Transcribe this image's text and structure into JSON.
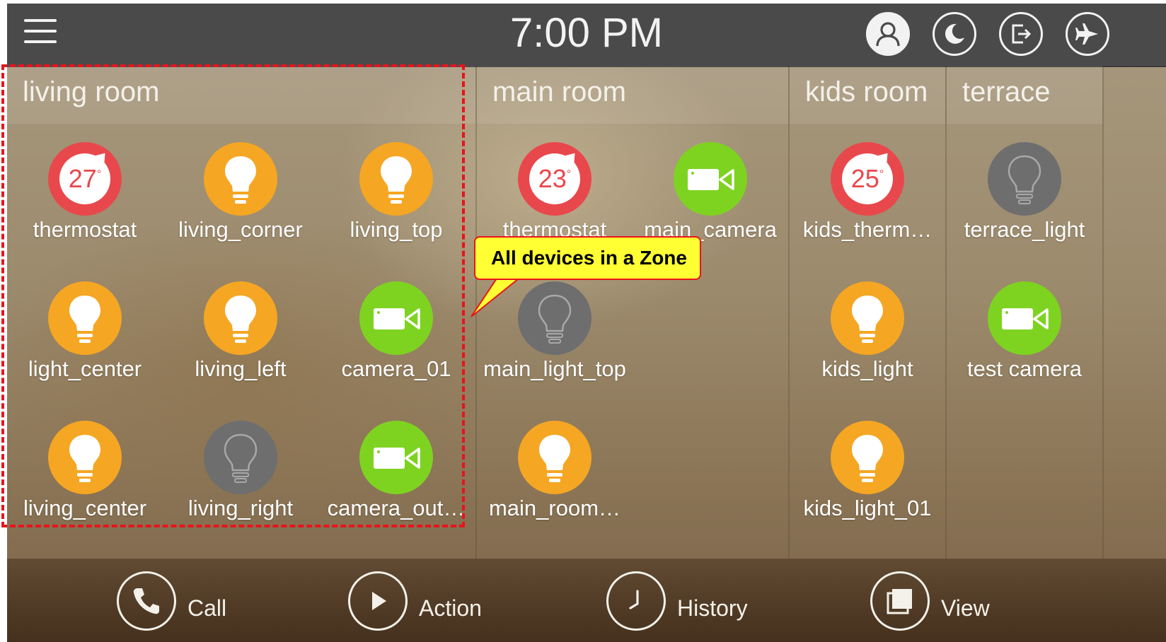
{
  "topbar": {
    "time": "7:00 PM",
    "icons": [
      "menu-icon",
      "user-icon",
      "moon-icon",
      "exit-icon",
      "airplane-icon"
    ]
  },
  "zones": [
    {
      "name": "living room",
      "devices": [
        {
          "label": "thermostat",
          "type": "thermostat",
          "value": "27"
        },
        {
          "label": "living_corner",
          "type": "light",
          "state": "on"
        },
        {
          "label": "living_top",
          "type": "light",
          "state": "on"
        },
        {
          "label": "light_center",
          "type": "light",
          "state": "on"
        },
        {
          "label": "living_left",
          "type": "light",
          "state": "on"
        },
        {
          "label": "camera_01",
          "type": "camera"
        },
        {
          "label": "living_center",
          "type": "light",
          "state": "on"
        },
        {
          "label": "living_right",
          "type": "light",
          "state": "off"
        },
        {
          "label": "camera_out…",
          "type": "camera"
        }
      ]
    },
    {
      "name": "main room",
      "devices": [
        {
          "label": "thermostat",
          "type": "thermostat",
          "value": "23"
        },
        {
          "label": "main_camera",
          "type": "camera"
        },
        {
          "label": "main_light_top",
          "type": "light",
          "state": "off"
        },
        {
          "label": "main_room…",
          "type": "light",
          "state": "on"
        }
      ]
    },
    {
      "name": "kids room",
      "devices": [
        {
          "label": "kids_therm…",
          "type": "thermostat",
          "value": "25"
        },
        {
          "label": "kids_light",
          "type": "light",
          "state": "on"
        },
        {
          "label": "kids_light_01",
          "type": "light",
          "state": "on"
        }
      ]
    },
    {
      "name": "terrace",
      "devices": [
        {
          "label": "terrace_light",
          "type": "light",
          "state": "off"
        },
        {
          "label": "test camera",
          "type": "camera"
        }
      ]
    }
  ],
  "bottombar": {
    "call": "Call",
    "action": "Action",
    "history": "History",
    "view": "View"
  },
  "annotation": {
    "callout": "All devices in a Zone"
  },
  "colors": {
    "light_on": "#f5a623",
    "light_off": "#6e6e6e",
    "camera": "#7ed321",
    "thermostat": "#e8484c",
    "annotation_red": "#e8141c",
    "annotation_yellow": "#ffff33"
  }
}
